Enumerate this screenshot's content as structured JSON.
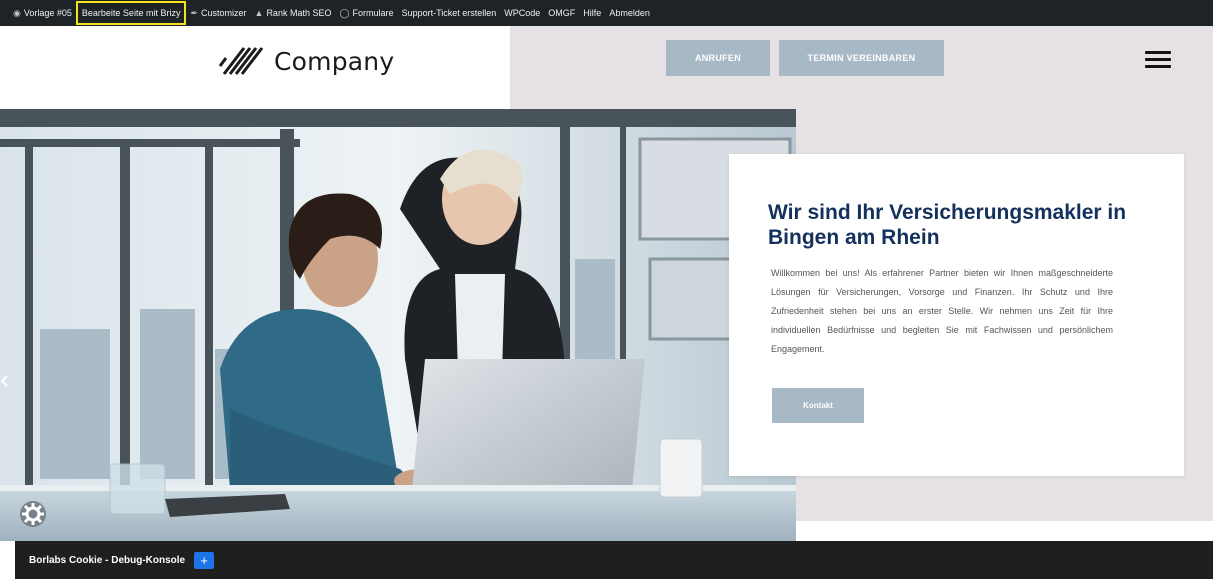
{
  "adminbar": {
    "items": [
      {
        "label": "Vorlage #05",
        "icon": "palette-icon"
      },
      {
        "label": "Bearbeite Seite mit Brizy",
        "icon": ""
      },
      {
        "label": "Customizer",
        "icon": "brush-icon"
      },
      {
        "label": "Rank Math SEO",
        "icon": "chart-icon"
      },
      {
        "label": "Formulare",
        "icon": "forms-icon"
      },
      {
        "label": "Support-Ticket erstellen",
        "icon": ""
      },
      {
        "label": "WPCode",
        "icon": ""
      },
      {
        "label": "OMGF",
        "icon": ""
      },
      {
        "label": "Hilfe",
        "icon": ""
      },
      {
        "label": "Abmelden",
        "icon": ""
      }
    ]
  },
  "header": {
    "logo_text": "Company",
    "btn_call": "ANRUFEN",
    "btn_appointment": "TERMIN VEREINBAREN"
  },
  "hero": {
    "title": "Wir sind Ihr Versicherungsmakler in Bingen am Rhein",
    "text": "Willkommen bei uns! Als erfahrener Partner bieten wir Ihnen maßgeschneiderte Lösungen für Versicherungen, Vorsorge und Finanzen. Ihr Schutz und Ihre Zufriedenheit stehen bei uns an erster Stelle. Wir nehmen uns Zeit für Ihre individuellen Bedürfnisse und begleiten Sie mit Fachwissen und persönlichem Engagement.",
    "button": "Kontakt"
  },
  "debug": {
    "label": "Borlabs Cookie - Debug-Konsole",
    "plus": "+"
  },
  "colors": {
    "accent": "#a8b9c6",
    "title": "#13315c",
    "adminbar": "#1d2327",
    "panel": "#e5e1e5"
  }
}
